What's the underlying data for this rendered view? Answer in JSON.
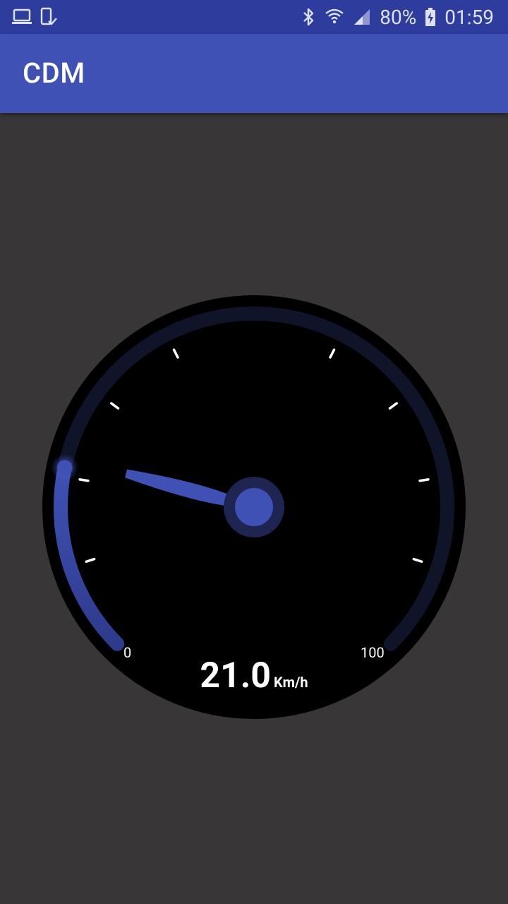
{
  "status_bar": {
    "battery": "80%",
    "time": "01:59",
    "icons": [
      "laptop-icon",
      "phone-check-icon",
      "bluetooth-icon",
      "wifi-icon",
      "signal-icon",
      "battery-charging-icon"
    ]
  },
  "app_bar": {
    "title": "CDM"
  },
  "speedometer": {
    "speed": "21.0",
    "unit": "Km/h",
    "min_label": "0",
    "max_label": "100",
    "fraction": 0.21,
    "colors": {
      "accent": "#3f51b5",
      "track": "#0f1428",
      "face": "#000000"
    }
  }
}
